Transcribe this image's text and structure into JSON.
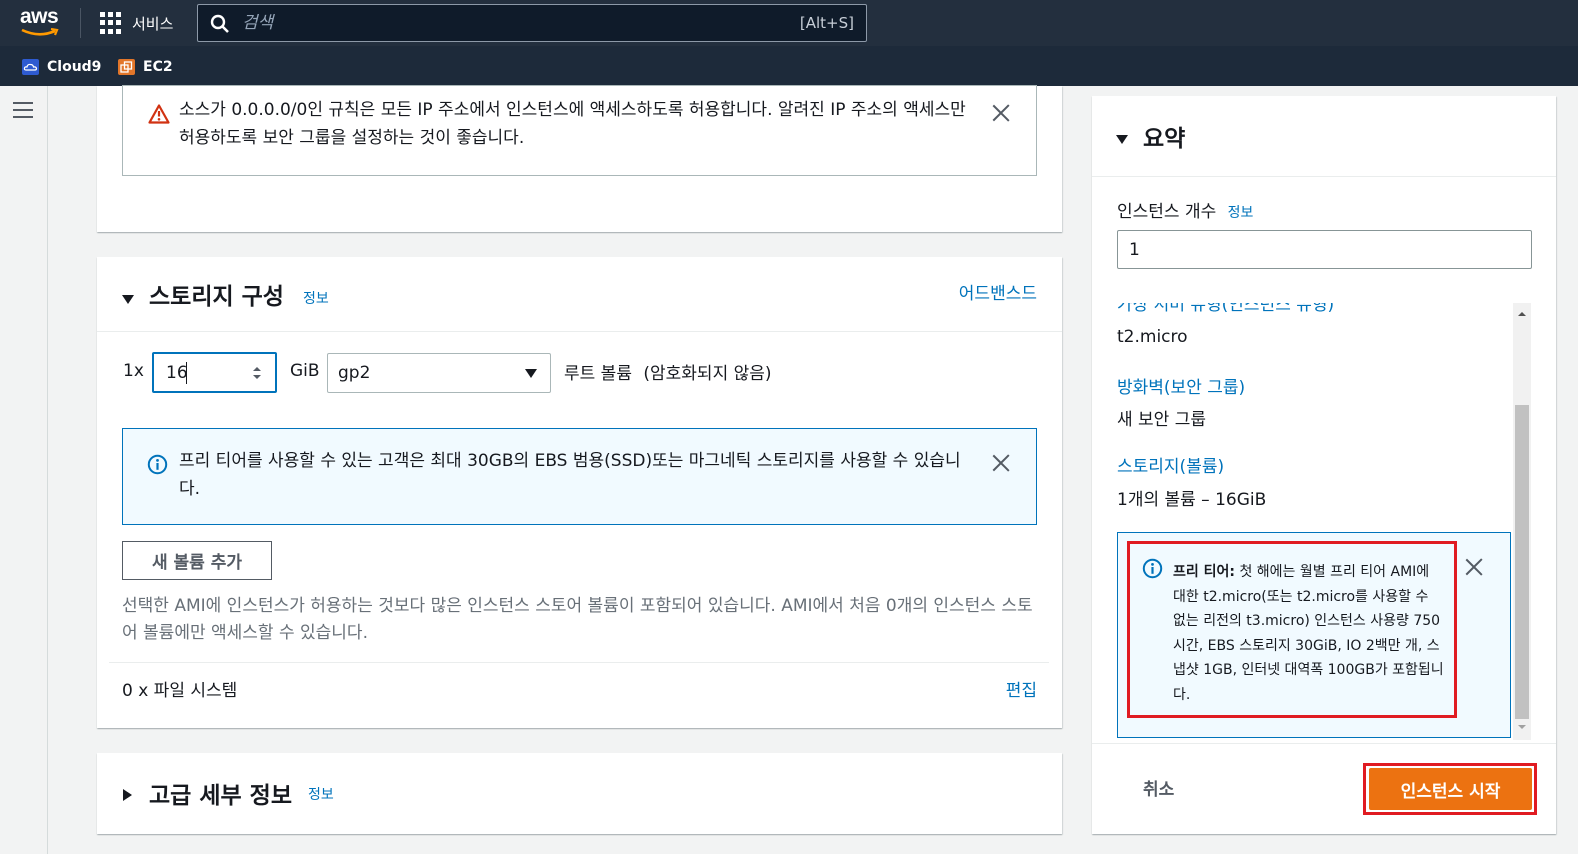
{
  "topnav": {
    "logo_text": "aws",
    "services_label": "서비스",
    "search_placeholder": "검색",
    "search_shortcut": "[Alt+S]"
  },
  "favorites": [
    {
      "label": "Cloud9",
      "icon": "cloud9-icon"
    },
    {
      "label": "EC2",
      "icon": "ec2-icon"
    }
  ],
  "security_warning": {
    "text": "소스가 0.0.0.0/0인 규칙은 모든 IP 주소에서 인스턴스에 액세스하도록 허용합니다. 알려진 IP 주소의 액세스만 허용하도록 보안 그룹을 설정하는 것이 좋습니다."
  },
  "storage": {
    "title": "스토리지 구성",
    "info_label": "정보",
    "advanced_link": "어드밴스드",
    "count_prefix": "1x",
    "size_value": "16",
    "size_unit": "GiB",
    "volume_type": "gp2",
    "root_volume_label": "루트 볼륨",
    "encryption_label": "(암호화되지 않음)",
    "free_tier_notice": "프리 티어를 사용할 수 있는 고객은 최대 30GB의 EBS 범용(SSD)또는 마그네틱 스토리지를 사용할 수 있습니다.",
    "add_volume_button": "새 볼륨 추가",
    "instance_store_note": "선택한 AMI에 인스턴스가 허용하는 것보다 많은 인스턴스 스토어 볼륨이 포함되어 있습니다. AMI에서 처음 0개의 인스턴스 스토어 볼륨에만 액세스할 수 있습니다.",
    "file_systems_label": "0 x 파일 시스템",
    "edit_link": "편집"
  },
  "advanced": {
    "title": "고급 세부 정보",
    "info_label": "정보"
  },
  "summary": {
    "title": "요약",
    "instance_count_label": "인스턴스 개수",
    "info_label": "정보",
    "instance_count_value": "1",
    "instance_type_label": "가상 서버 유형(인스턴스 유형)",
    "instance_type_value": "t2.micro",
    "firewall_label": "방화벽(보안 그룹)",
    "firewall_value": "새 보안 그룹",
    "storage_label": "스토리지(볼륨)",
    "storage_value": "1개의 볼륨 – 16GiB",
    "free_tier_title": "프리 티어:",
    "free_tier_text": "첫 해에는 월별 프리 티어 AMI에 대한 t2.micro(또는 t2.micro를 사용할 수 없는 리전의 t3.micro) 인스턴스 사용량 750시간, EBS 스토리지 30GiB, IO 2백만 개, 스냅샷 1GB, 인터넷 대역폭 100GB가 포함됩니다.",
    "cancel_button": "취소",
    "launch_button": "인스턴스 시작"
  },
  "colors": {
    "nav_bg": "#232f3e",
    "link": "#0073bb",
    "primary": "#ec7211",
    "highlight": "#e01b22",
    "warning": "#d13212"
  }
}
